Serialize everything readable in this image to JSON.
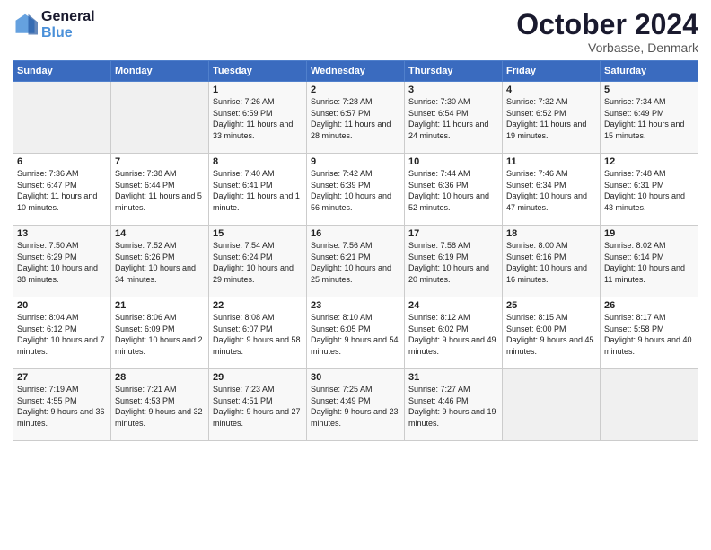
{
  "logo": {
    "line1": "General",
    "line2": "Blue"
  },
  "header": {
    "month": "October 2024",
    "location": "Vorbasse, Denmark"
  },
  "weekdays": [
    "Sunday",
    "Monday",
    "Tuesday",
    "Wednesday",
    "Thursday",
    "Friday",
    "Saturday"
  ],
  "weeks": [
    [
      {
        "day": "",
        "empty": true
      },
      {
        "day": "",
        "empty": true
      },
      {
        "day": "1",
        "sunrise": "Sunrise: 7:26 AM",
        "sunset": "Sunset: 6:59 PM",
        "daylight": "Daylight: 11 hours and 33 minutes."
      },
      {
        "day": "2",
        "sunrise": "Sunrise: 7:28 AM",
        "sunset": "Sunset: 6:57 PM",
        "daylight": "Daylight: 11 hours and 28 minutes."
      },
      {
        "day": "3",
        "sunrise": "Sunrise: 7:30 AM",
        "sunset": "Sunset: 6:54 PM",
        "daylight": "Daylight: 11 hours and 24 minutes."
      },
      {
        "day": "4",
        "sunrise": "Sunrise: 7:32 AM",
        "sunset": "Sunset: 6:52 PM",
        "daylight": "Daylight: 11 hours and 19 minutes."
      },
      {
        "day": "5",
        "sunrise": "Sunrise: 7:34 AM",
        "sunset": "Sunset: 6:49 PM",
        "daylight": "Daylight: 11 hours and 15 minutes."
      }
    ],
    [
      {
        "day": "6",
        "sunrise": "Sunrise: 7:36 AM",
        "sunset": "Sunset: 6:47 PM",
        "daylight": "Daylight: 11 hours and 10 minutes."
      },
      {
        "day": "7",
        "sunrise": "Sunrise: 7:38 AM",
        "sunset": "Sunset: 6:44 PM",
        "daylight": "Daylight: 11 hours and 5 minutes."
      },
      {
        "day": "8",
        "sunrise": "Sunrise: 7:40 AM",
        "sunset": "Sunset: 6:41 PM",
        "daylight": "Daylight: 11 hours and 1 minute."
      },
      {
        "day": "9",
        "sunrise": "Sunrise: 7:42 AM",
        "sunset": "Sunset: 6:39 PM",
        "daylight": "Daylight: 10 hours and 56 minutes."
      },
      {
        "day": "10",
        "sunrise": "Sunrise: 7:44 AM",
        "sunset": "Sunset: 6:36 PM",
        "daylight": "Daylight: 10 hours and 52 minutes."
      },
      {
        "day": "11",
        "sunrise": "Sunrise: 7:46 AM",
        "sunset": "Sunset: 6:34 PM",
        "daylight": "Daylight: 10 hours and 47 minutes."
      },
      {
        "day": "12",
        "sunrise": "Sunrise: 7:48 AM",
        "sunset": "Sunset: 6:31 PM",
        "daylight": "Daylight: 10 hours and 43 minutes."
      }
    ],
    [
      {
        "day": "13",
        "sunrise": "Sunrise: 7:50 AM",
        "sunset": "Sunset: 6:29 PM",
        "daylight": "Daylight: 10 hours and 38 minutes."
      },
      {
        "day": "14",
        "sunrise": "Sunrise: 7:52 AM",
        "sunset": "Sunset: 6:26 PM",
        "daylight": "Daylight: 10 hours and 34 minutes."
      },
      {
        "day": "15",
        "sunrise": "Sunrise: 7:54 AM",
        "sunset": "Sunset: 6:24 PM",
        "daylight": "Daylight: 10 hours and 29 minutes."
      },
      {
        "day": "16",
        "sunrise": "Sunrise: 7:56 AM",
        "sunset": "Sunset: 6:21 PM",
        "daylight": "Daylight: 10 hours and 25 minutes."
      },
      {
        "day": "17",
        "sunrise": "Sunrise: 7:58 AM",
        "sunset": "Sunset: 6:19 PM",
        "daylight": "Daylight: 10 hours and 20 minutes."
      },
      {
        "day": "18",
        "sunrise": "Sunrise: 8:00 AM",
        "sunset": "Sunset: 6:16 PM",
        "daylight": "Daylight: 10 hours and 16 minutes."
      },
      {
        "day": "19",
        "sunrise": "Sunrise: 8:02 AM",
        "sunset": "Sunset: 6:14 PM",
        "daylight": "Daylight: 10 hours and 11 minutes."
      }
    ],
    [
      {
        "day": "20",
        "sunrise": "Sunrise: 8:04 AM",
        "sunset": "Sunset: 6:12 PM",
        "daylight": "Daylight: 10 hours and 7 minutes."
      },
      {
        "day": "21",
        "sunrise": "Sunrise: 8:06 AM",
        "sunset": "Sunset: 6:09 PM",
        "daylight": "Daylight: 10 hours and 2 minutes."
      },
      {
        "day": "22",
        "sunrise": "Sunrise: 8:08 AM",
        "sunset": "Sunset: 6:07 PM",
        "daylight": "Daylight: 9 hours and 58 minutes."
      },
      {
        "day": "23",
        "sunrise": "Sunrise: 8:10 AM",
        "sunset": "Sunset: 6:05 PM",
        "daylight": "Daylight: 9 hours and 54 minutes."
      },
      {
        "day": "24",
        "sunrise": "Sunrise: 8:12 AM",
        "sunset": "Sunset: 6:02 PM",
        "daylight": "Daylight: 9 hours and 49 minutes."
      },
      {
        "day": "25",
        "sunrise": "Sunrise: 8:15 AM",
        "sunset": "Sunset: 6:00 PM",
        "daylight": "Daylight: 9 hours and 45 minutes."
      },
      {
        "day": "26",
        "sunrise": "Sunrise: 8:17 AM",
        "sunset": "Sunset: 5:58 PM",
        "daylight": "Daylight: 9 hours and 40 minutes."
      }
    ],
    [
      {
        "day": "27",
        "sunrise": "Sunrise: 7:19 AM",
        "sunset": "Sunset: 4:55 PM",
        "daylight": "Daylight: 9 hours and 36 minutes."
      },
      {
        "day": "28",
        "sunrise": "Sunrise: 7:21 AM",
        "sunset": "Sunset: 4:53 PM",
        "daylight": "Daylight: 9 hours and 32 minutes."
      },
      {
        "day": "29",
        "sunrise": "Sunrise: 7:23 AM",
        "sunset": "Sunset: 4:51 PM",
        "daylight": "Daylight: 9 hours and 27 minutes."
      },
      {
        "day": "30",
        "sunrise": "Sunrise: 7:25 AM",
        "sunset": "Sunset: 4:49 PM",
        "daylight": "Daylight: 9 hours and 23 minutes."
      },
      {
        "day": "31",
        "sunrise": "Sunrise: 7:27 AM",
        "sunset": "Sunset: 4:46 PM",
        "daylight": "Daylight: 9 hours and 19 minutes."
      },
      {
        "day": "",
        "empty": true
      },
      {
        "day": "",
        "empty": true
      }
    ]
  ]
}
